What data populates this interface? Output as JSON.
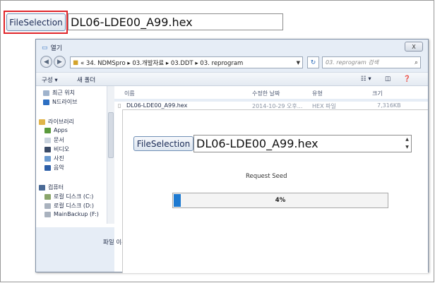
{
  "top": {
    "button_label": "FileSelection",
    "file_field_value": "DL06-LDE00_A99.hex"
  },
  "dialog": {
    "title": "열기",
    "close_label": "X",
    "address": "« 34. NDMSpro ▸ 03.개발자료 ▸ 03.DDT ▸ 03. reprogram",
    "search_placeholder": "03. reprogram 검색",
    "toolbar": {
      "organize": "구성 ▾",
      "new_folder": "새 폴더"
    },
    "nav": {
      "recent": "최근 위치",
      "ndrive": "N드라이브",
      "libraries": "라이브러리",
      "apps": "Apps",
      "documents": "문서",
      "videos": "비디오",
      "pictures": "사진",
      "music": "음악",
      "computer": "컴퓨터",
      "disk_c": "로컬 디스크 (C:)",
      "disk_d": "로컬 디스크 (D:)",
      "disk_f": "MainBackup (F:)"
    },
    "columns": {
      "name": "이름",
      "date": "수정한 날짜",
      "type": "유형",
      "size": "크기"
    },
    "files": [
      {
        "name": "DL06-LDE00_A99.hex",
        "date": "2014-10-29 오후...",
        "type": "HEX 파일",
        "size": "7,316KB"
      }
    ],
    "filename_label": "파일 이-"
  },
  "overlay": {
    "button_label": "FileSelection",
    "file_field_value": "DL06-LDE00_A99.hex",
    "status_text": "Request Seed",
    "progress_percent": 4,
    "progress_label": "4%"
  },
  "colors": {
    "highlight": "#e0252a",
    "progress_fill": "#1e7ad1"
  }
}
